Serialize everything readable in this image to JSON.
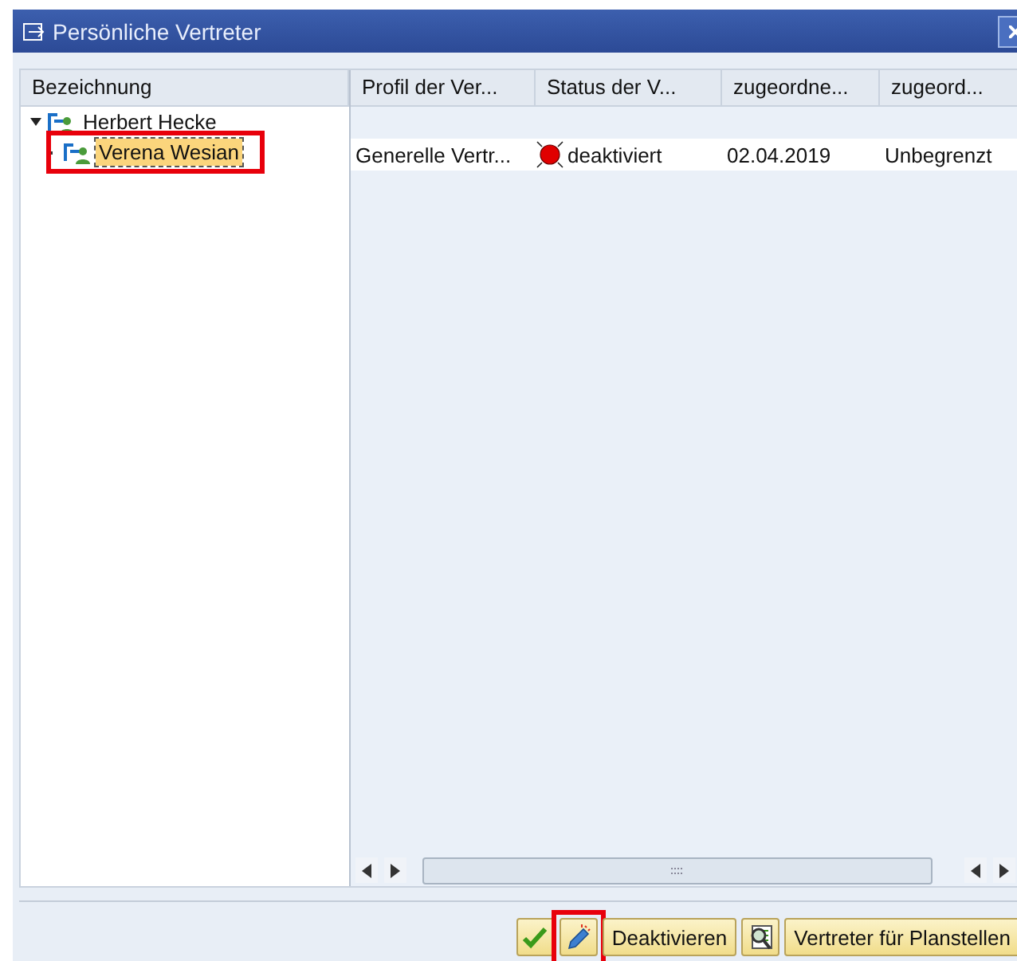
{
  "window": {
    "title": "Persönliche Vertreter"
  },
  "tree": {
    "header": "Bezeichnung",
    "items": [
      {
        "label": "Herbert Hecke",
        "expanded": true,
        "selected": false,
        "highlighted": false,
        "children": [
          {
            "label": "Verena Wesian",
            "selected": true,
            "highlighted": true
          }
        ]
      }
    ]
  },
  "table": {
    "columns": [
      "Profil der Ver...",
      "Status der V...",
      "zugeordne...",
      "zugeord..."
    ],
    "rows": [
      {
        "cells": [
          "Generelle Vertr...",
          "deaktiviert",
          "02.04.2019",
          "Unbegrenzt"
        ]
      }
    ]
  },
  "buttons": [
    {
      "kind": "confirm",
      "highlighted": false
    },
    {
      "kind": "edit",
      "highlighted": true
    },
    {
      "kind": "text",
      "label": "Deaktivieren",
      "highlighted": false
    },
    {
      "kind": "inspect",
      "highlighted": false
    },
    {
      "kind": "text",
      "label": "Vertreter für Planstellen",
      "highlighted": false
    }
  ]
}
